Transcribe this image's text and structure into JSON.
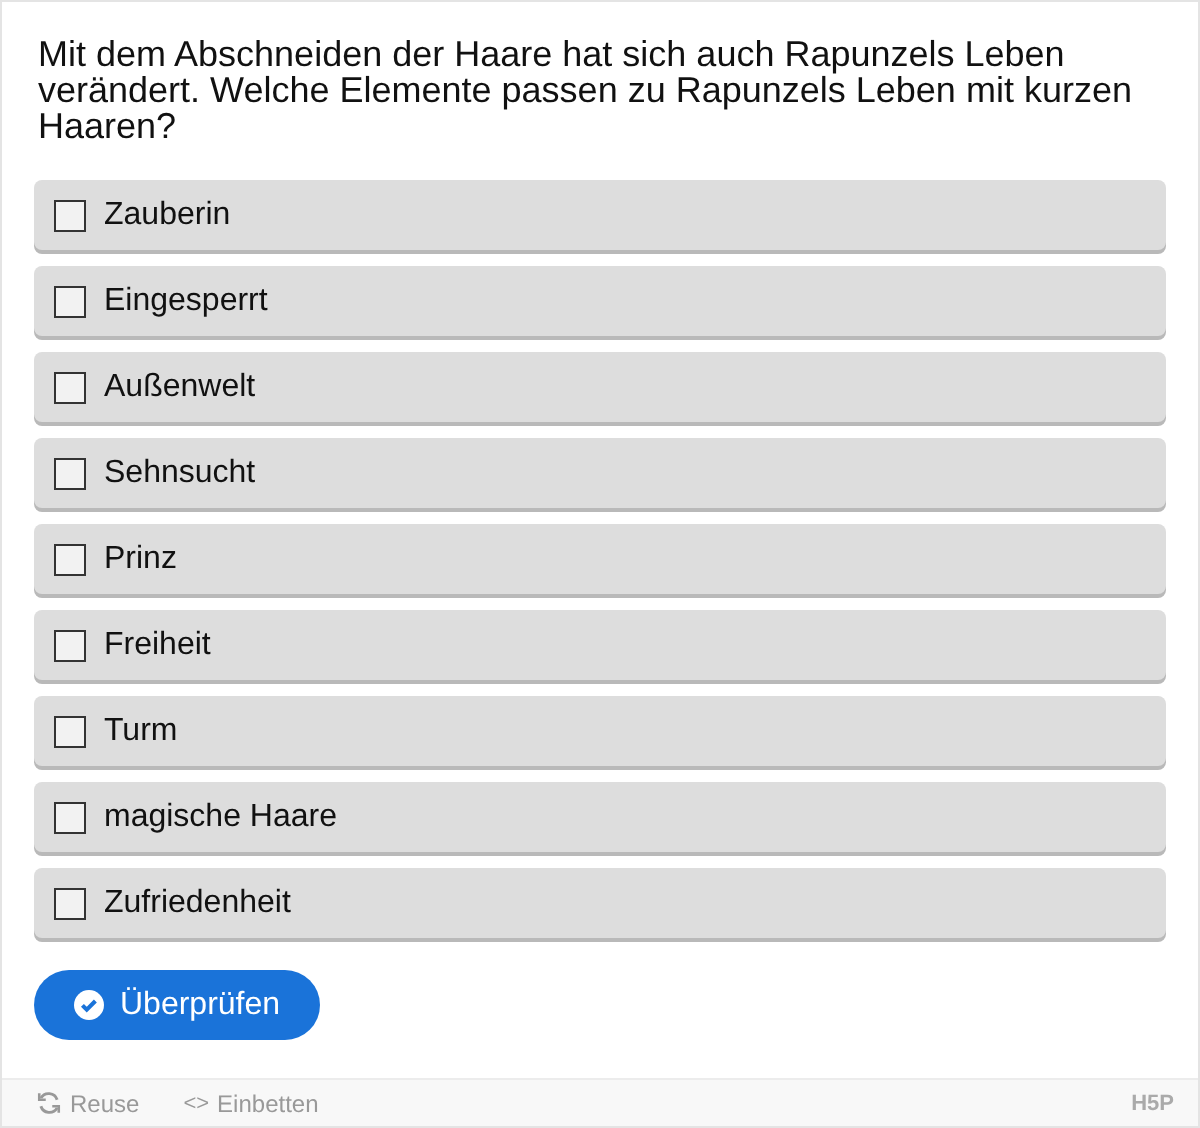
{
  "question": "Mit dem Abschneiden der Haare hat sich auch Rapunzels Leben verändert. Welche Elemente passen zu Rapunzels Leben mit kurzen Haaren?",
  "options": [
    {
      "label": "Zauberin",
      "checked": false
    },
    {
      "label": "Eingesperrt",
      "checked": false
    },
    {
      "label": "Außenwelt",
      "checked": false
    },
    {
      "label": "Sehnsucht",
      "checked": false
    },
    {
      "label": "Prinz",
      "checked": false
    },
    {
      "label": "Freiheit",
      "checked": false
    },
    {
      "label": "Turm",
      "checked": false
    },
    {
      "label": "magische Haare",
      "checked": false
    },
    {
      "label": "Zufriedenheit",
      "checked": false
    }
  ],
  "check_button": "Überprüfen",
  "footer": {
    "reuse": "Reuse",
    "embed_icon": "<>",
    "embed": "Einbetten",
    "logo": "H5P"
  }
}
